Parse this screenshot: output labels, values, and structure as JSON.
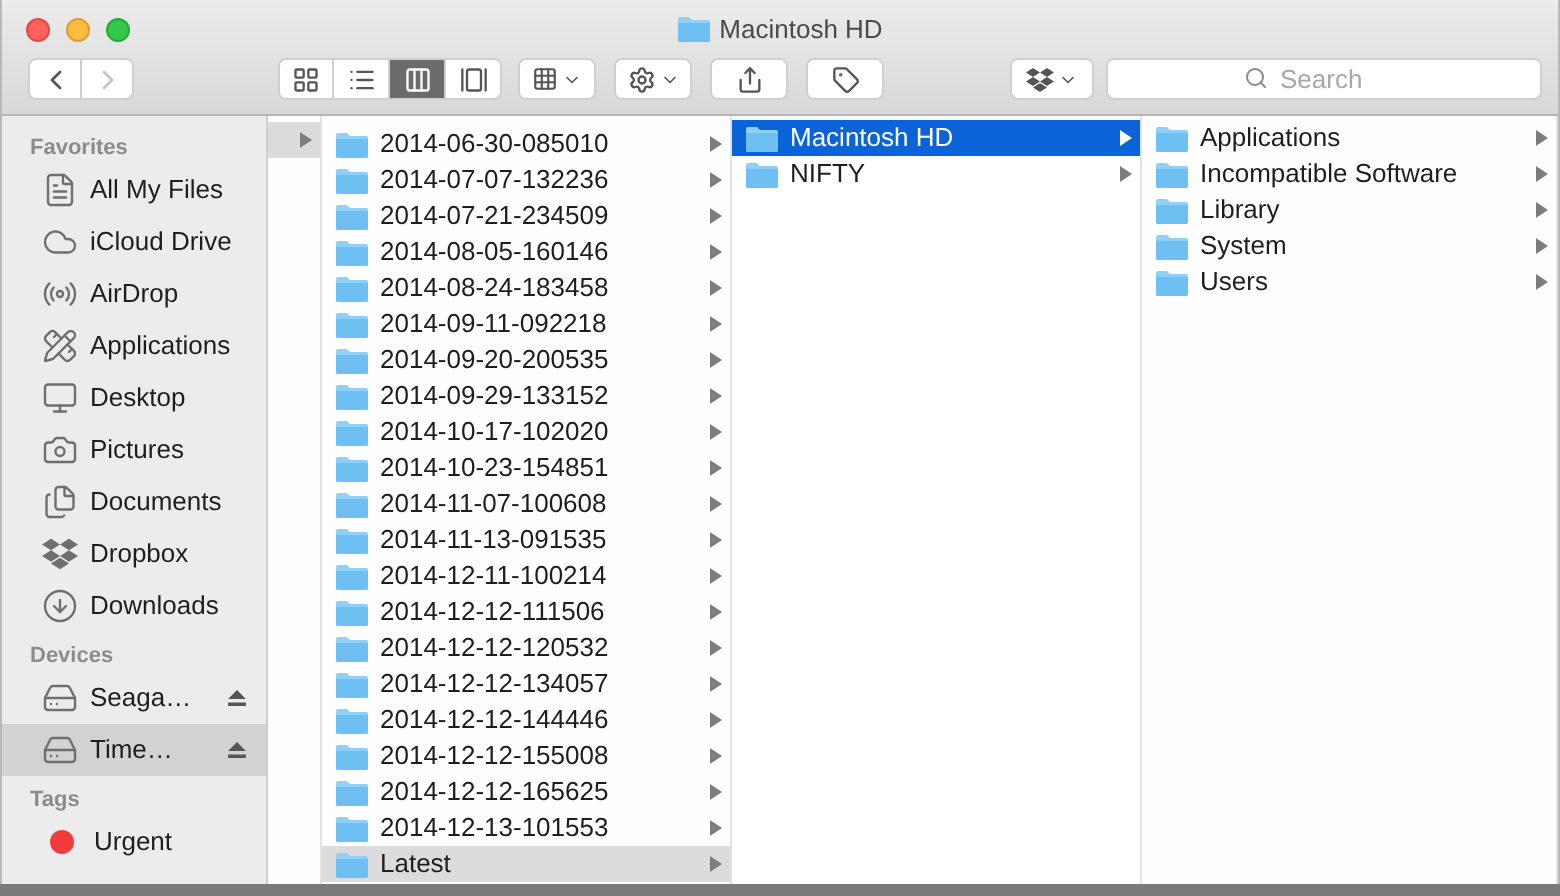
{
  "window": {
    "title": "Macintosh HD"
  },
  "toolbar": {
    "back": {
      "disabled": false
    },
    "forward": {
      "disabled": true
    },
    "view_modes": [
      {
        "kind": "icons",
        "selected": false
      },
      {
        "kind": "list",
        "selected": false
      },
      {
        "kind": "columns",
        "selected": true
      },
      {
        "kind": "coverflow",
        "selected": false
      }
    ],
    "search": {
      "placeholder": "Search"
    }
  },
  "sidebar": {
    "sections": [
      {
        "title": "Favorites",
        "items": [
          {
            "kind": "files",
            "label": "All My Files",
            "selected": false
          },
          {
            "kind": "cloud",
            "label": "iCloud Drive",
            "selected": false
          },
          {
            "kind": "airdrop",
            "label": "AirDrop",
            "selected": false
          },
          {
            "kind": "apps",
            "label": "Applications",
            "selected": false
          },
          {
            "kind": "desktop",
            "label": "Desktop",
            "selected": false
          },
          {
            "kind": "pictures",
            "label": "Pictures",
            "selected": false
          },
          {
            "kind": "documents",
            "label": "Documents",
            "selected": false
          },
          {
            "kind": "dropbox",
            "label": "Dropbox",
            "selected": false
          },
          {
            "kind": "downloads",
            "label": "Downloads",
            "selected": false
          }
        ]
      },
      {
        "title": "Devices",
        "items": [
          {
            "kind": "drive",
            "label": "Seaga…",
            "selected": false,
            "eject": true
          },
          {
            "kind": "drive",
            "label": "Time…",
            "selected": true,
            "eject": true
          }
        ]
      },
      {
        "title": "Tags",
        "items": [
          {
            "kind": "tag",
            "label": "Urgent",
            "selected": false,
            "color": "#f23c3c"
          }
        ]
      }
    ]
  },
  "columns": [
    {
      "focused": false,
      "items": [
        {
          "selected": true,
          "expandable": true
        }
      ]
    },
    {
      "focused": false,
      "items": [
        {
          "label": "2014-06-30-085010",
          "selected": false,
          "expandable": true
        },
        {
          "label": "2014-07-07-132236",
          "selected": false,
          "expandable": true
        },
        {
          "label": "2014-07-21-234509",
          "selected": false,
          "expandable": true
        },
        {
          "label": "2014-08-05-160146",
          "selected": false,
          "expandable": true
        },
        {
          "label": "2014-08-24-183458",
          "selected": false,
          "expandable": true
        },
        {
          "label": "2014-09-11-092218",
          "selected": false,
          "expandable": true
        },
        {
          "label": "2014-09-20-200535",
          "selected": false,
          "expandable": true
        },
        {
          "label": "2014-09-29-133152",
          "selected": false,
          "expandable": true
        },
        {
          "label": "2014-10-17-102020",
          "selected": false,
          "expandable": true
        },
        {
          "label": "2014-10-23-154851",
          "selected": false,
          "expandable": true
        },
        {
          "label": "2014-11-07-100608",
          "selected": false,
          "expandable": true
        },
        {
          "label": "2014-11-13-091535",
          "selected": false,
          "expandable": true
        },
        {
          "label": "2014-12-11-100214",
          "selected": false,
          "expandable": true
        },
        {
          "label": "2014-12-12-111506",
          "selected": false,
          "expandable": true
        },
        {
          "label": "2014-12-12-120532",
          "selected": false,
          "expandable": true
        },
        {
          "label": "2014-12-12-134057",
          "selected": false,
          "expandable": true
        },
        {
          "label": "2014-12-12-144446",
          "selected": false,
          "expandable": true
        },
        {
          "label": "2014-12-12-155008",
          "selected": false,
          "expandable": true
        },
        {
          "label": "2014-12-12-165625",
          "selected": false,
          "expandable": true
        },
        {
          "label": "2014-12-13-101553",
          "selected": false,
          "expandable": true
        },
        {
          "label": "Latest",
          "selected": true,
          "expandable": true
        }
      ]
    },
    {
      "focused": true,
      "items": [
        {
          "label": "Macintosh HD",
          "selected": true,
          "expandable": true
        },
        {
          "label": "NIFTY",
          "selected": false,
          "expandable": true
        }
      ]
    },
    {
      "focused": false,
      "items": [
        {
          "label": "Applications",
          "selected": false,
          "expandable": true
        },
        {
          "label": "Incompatible Software",
          "selected": false,
          "expandable": true
        },
        {
          "label": "Library",
          "selected": false,
          "expandable": true
        },
        {
          "label": "System",
          "selected": false,
          "expandable": true
        },
        {
          "label": "Users",
          "selected": false,
          "expandable": true
        }
      ]
    }
  ]
}
